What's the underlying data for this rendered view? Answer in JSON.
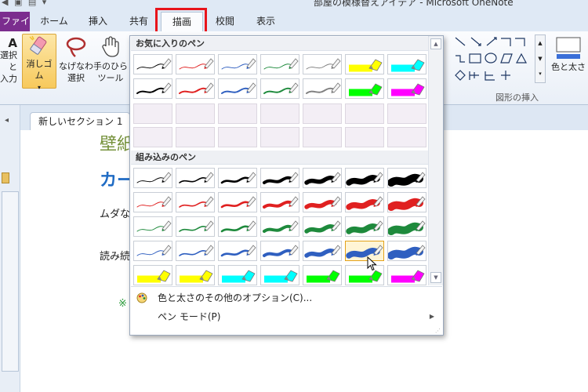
{
  "window": {
    "title": "部屋の模様替えアイデア - Microsoft OneNote"
  },
  "ribbon": {
    "file_tab": "ファイル",
    "tabs": [
      "ホーム",
      "挿入",
      "共有",
      "描画",
      "校閲",
      "表示"
    ],
    "active_tab": "描画",
    "buttons": {
      "select_text": [
        "選択と",
        "入力"
      ],
      "eraser": "消しゴム",
      "lasso": [
        "なげなわ",
        "選択"
      ],
      "hand": [
        "手のひら",
        "ツール"
      ],
      "color_thickness": "色と太さ"
    },
    "group_insert_shapes": "図形の挿入",
    "colors": {
      "file_tab": "#7b2d8e",
      "highlight": "#e8141b",
      "accent_blue": "#3a7bd5"
    }
  },
  "section_tab": "新しいセクション 1",
  "page_fragments": {
    "heading1": "壁紙",
    "heading2": "カー",
    "line1": "ムダな",
    "line2": "読み続",
    "note_mark": "※"
  },
  "gallery": {
    "favorites_header": "お気に入りのペン",
    "builtin_header": "組み込みのペン",
    "favorites": [
      [
        {
          "c": "#000000",
          "w": 1
        },
        {
          "c": "#e02020",
          "w": 1
        },
        {
          "c": "#2f5fc0",
          "w": 1
        },
        {
          "c": "#1e8a3c",
          "w": 1
        },
        {
          "c": "#808080",
          "w": 1
        },
        {
          "c": "#ffff00",
          "w": 9
        },
        {
          "c": "#00ffff",
          "w": 9
        }
      ],
      [
        {
          "c": "#000000",
          "w": 2
        },
        {
          "c": "#e02020",
          "w": 2
        },
        {
          "c": "#2f5fc0",
          "w": 2
        },
        {
          "c": "#1e8a3c",
          "w": 2
        },
        {
          "c": "#808080",
          "w": 2
        },
        {
          "c": "#00ff00",
          "w": 9
        },
        {
          "c": "#ff00ff",
          "w": 9
        }
      ]
    ],
    "favorites_empty_rows": 2,
    "builtin_colors": [
      "#000000",
      "#e02020",
      "#1e8a3c",
      "#2f5fc0"
    ],
    "builtin_widths": [
      1,
      1.6,
      2.6,
      4,
      5.5,
      7.5,
      10
    ],
    "highlighters": [
      "#ffff00",
      "#ffff00",
      "#00ffff",
      "#00ffff",
      "#00ff00",
      "#00ff00",
      "#ff00ff"
    ],
    "selected_index": {
      "row": 3,
      "col": 5
    },
    "menu": {
      "more_options": "色と太さのその他のオプション(C)...",
      "pen_mode": "ペン モード(P)"
    }
  },
  "icons": {
    "eraser": "eraser-icon",
    "lasso": "lasso-icon",
    "hand": "hand-icon",
    "palette": "palette-icon",
    "submenu_arrow": "submenu-arrow-icon",
    "scroll_up": "scroll-up-icon",
    "scroll_down": "scroll-down-icon",
    "cursor": "mouse-cursor-icon"
  }
}
